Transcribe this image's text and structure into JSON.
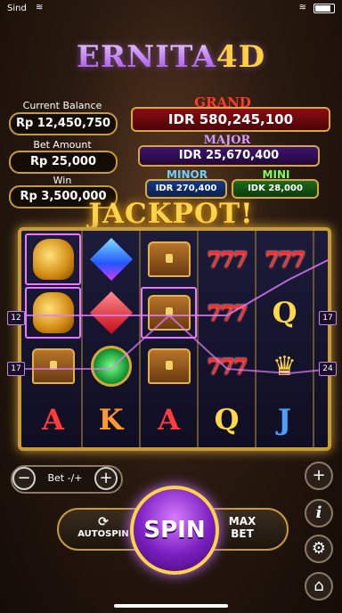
{
  "status": {
    "carrier": "Sind",
    "wifi_icon": "wifi-icon"
  },
  "title": {
    "main": "ERNITA",
    "suffix": "4D"
  },
  "info": {
    "current_balance_label": "Current Balance",
    "current_balance": "Rp 12,450,750",
    "bet_amount_label": "Bet Amount",
    "bet_amount": "Rp 25,000",
    "win_label": "Win",
    "win": "Rp 3,500,000"
  },
  "jackpots": {
    "grand_label": "GRAND",
    "grand": "IDR 580,245,100",
    "major_label": "MAJOR",
    "major": "IDR 25,670,400",
    "minor_label": "MINOR",
    "minor": "IDR 270,400",
    "mini_label": "MINI",
    "mini": "IDK 28,000"
  },
  "banner": "JACKPOT!",
  "reels": {
    "cols": [
      [
        "dragon",
        "dragon",
        "chest",
        "A"
      ],
      [
        "gem-blue",
        "gem-red",
        "gem-green",
        "K"
      ],
      [
        "chest",
        "chest",
        "chest",
        "A"
      ],
      [
        "777",
        "777",
        "777",
        "Q"
      ],
      [
        "777",
        "Q",
        "crown",
        "J"
      ]
    ],
    "line_numbers": {
      "left": [
        "12",
        "17"
      ],
      "right": [
        "17",
        "24"
      ]
    }
  },
  "controls": {
    "bet_label": "Bet -/+",
    "minus": "−",
    "plus": "+",
    "autospin": "AUTOSPIN",
    "spin": "SPIN",
    "max_bet": "MAX BET",
    "side_plus": "+",
    "info": "i",
    "settings": "⚙",
    "home": "⌂"
  },
  "colors": {
    "gold": "#c79a3a",
    "spin": "#7a1fc0",
    "grand": "#8a0c12"
  }
}
